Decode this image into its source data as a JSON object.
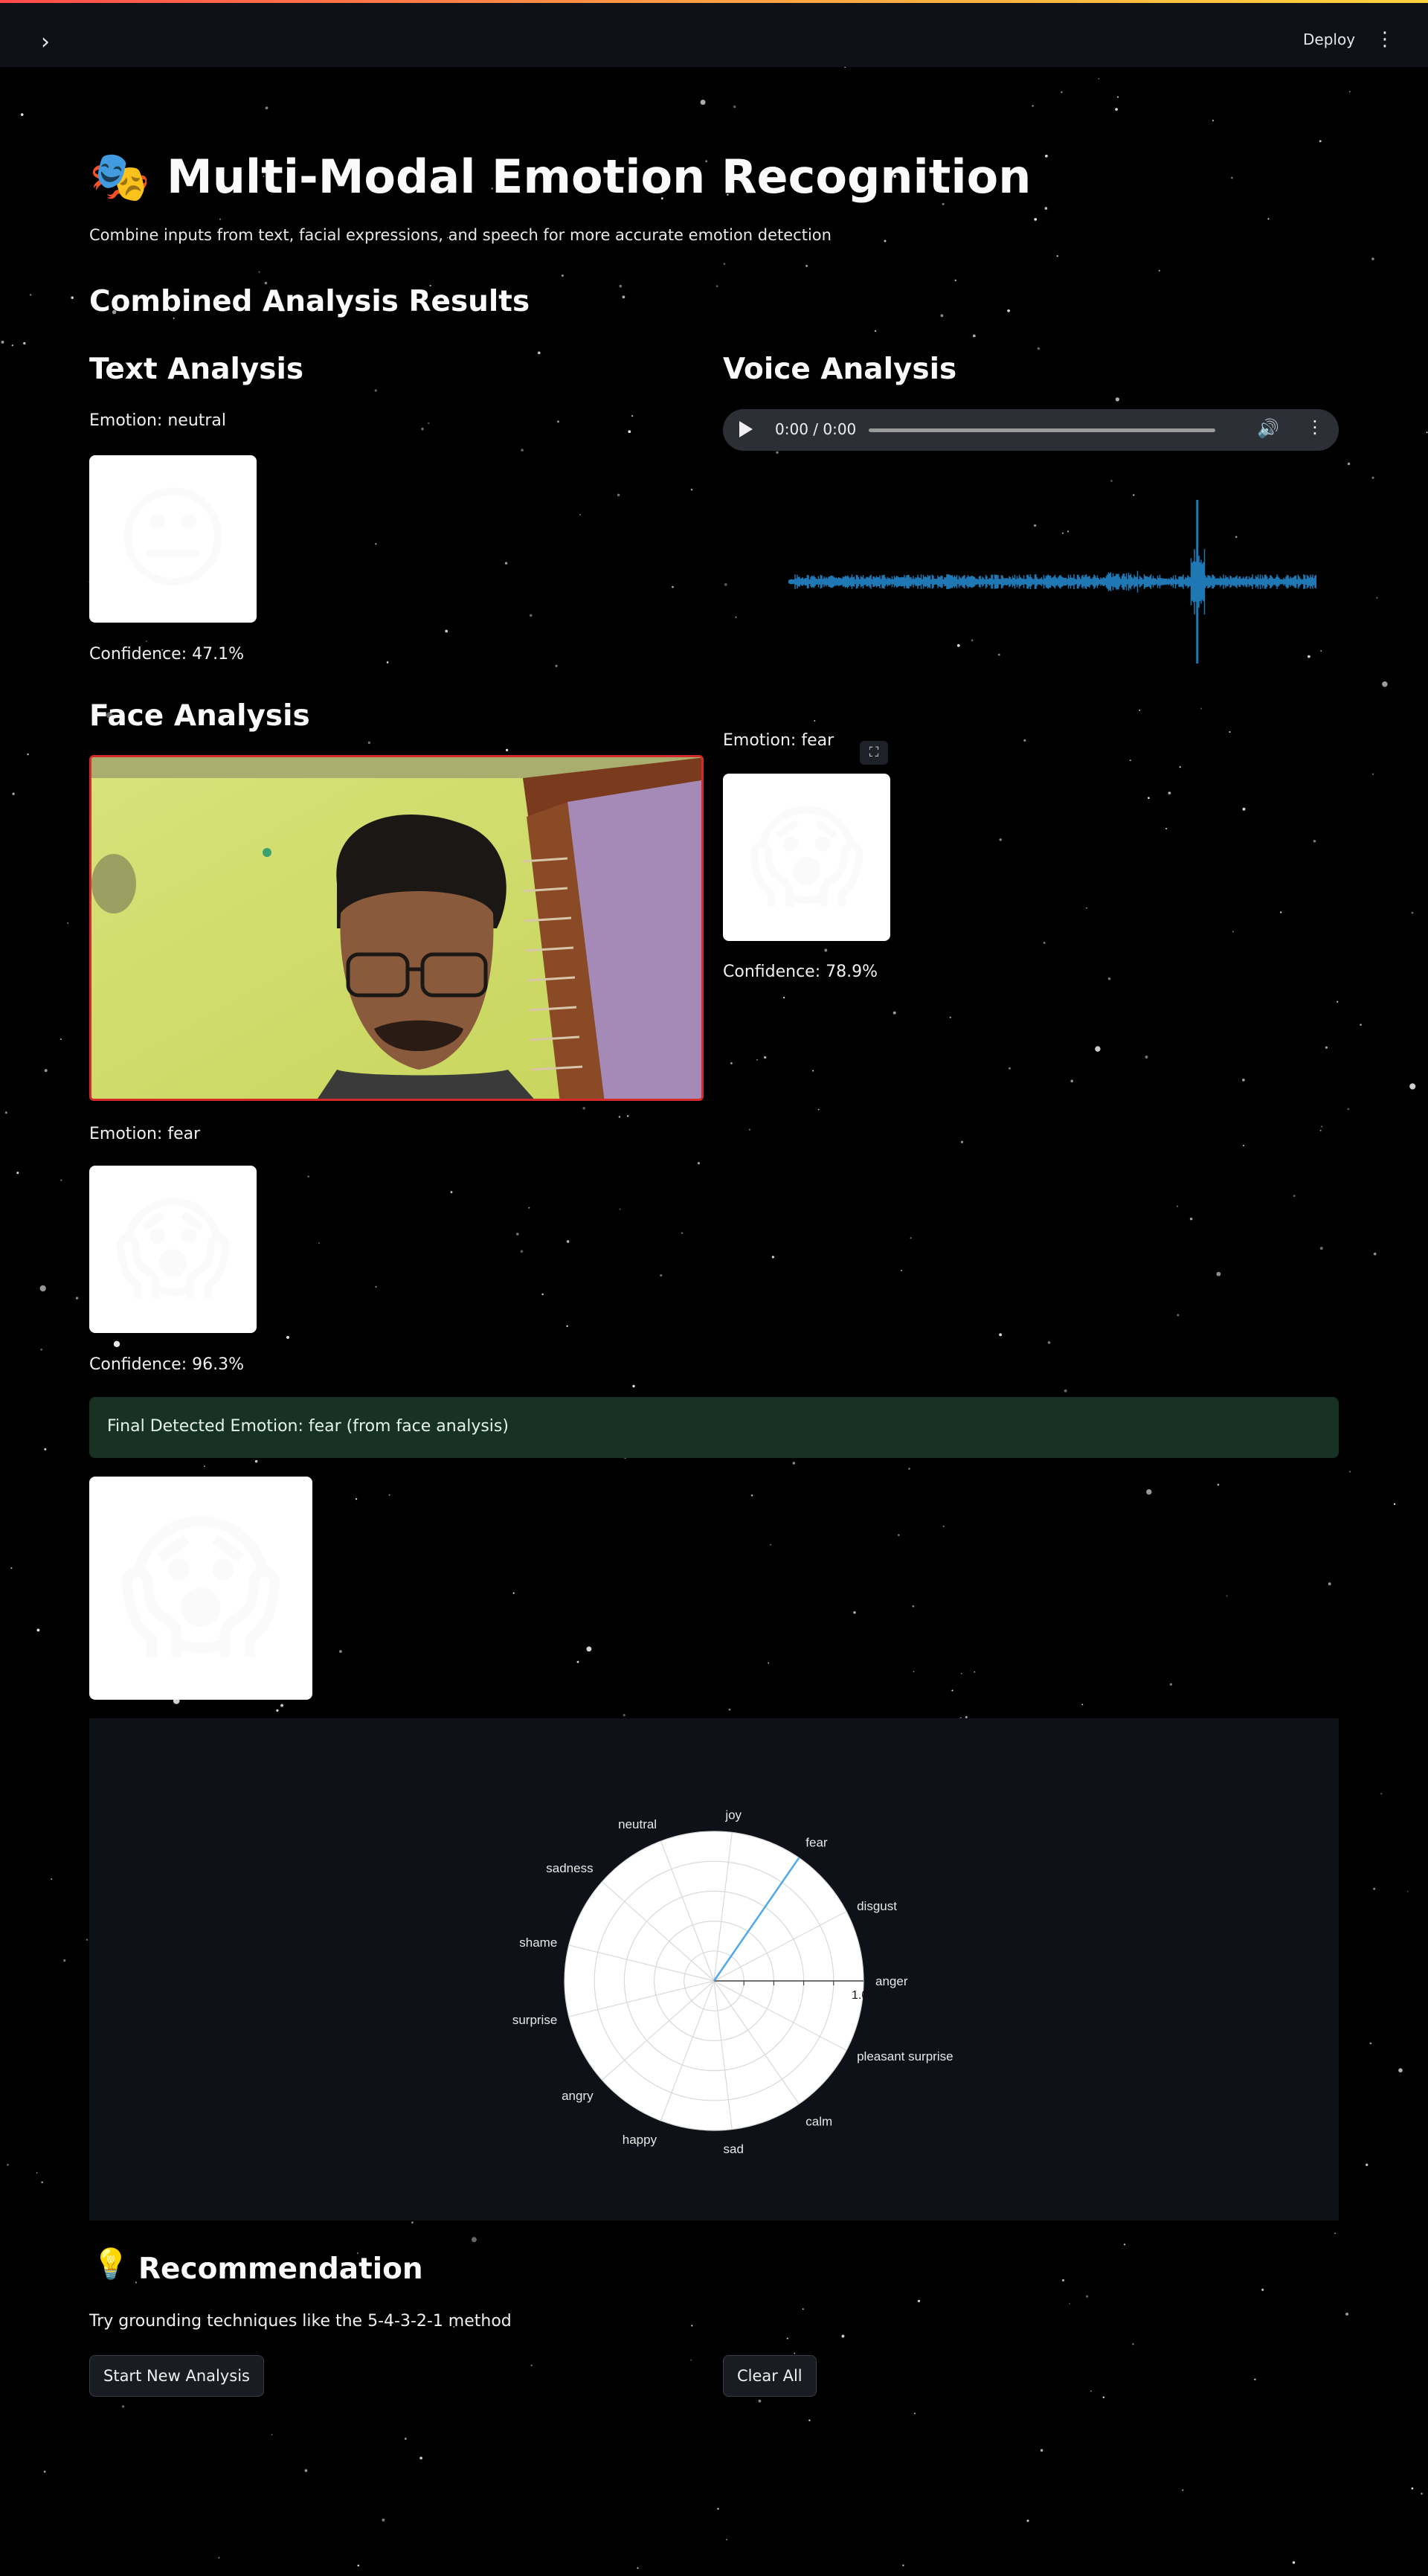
{
  "app": {
    "deploy_label": "Deploy",
    "sidebar_toggle_icon": "chevron-right-icon",
    "menu_icon": "kebab-menu-icon",
    "accent_gradient": [
      "#ff4b4b",
      "#ff9f43",
      "#ffd33d"
    ]
  },
  "header": {
    "title_emoji": "🎭",
    "title": "Multi-Modal Emotion Recognition",
    "subtitle": "Combine inputs from text, facial expressions, and speech for more accurate emotion detection"
  },
  "combined": {
    "heading": "Combined Analysis Results"
  },
  "text_analysis": {
    "heading": "Text Analysis",
    "emotion_label": "Emotion: neutral",
    "emoji": "😐",
    "confidence": "Confidence: 47.1%"
  },
  "voice_analysis": {
    "heading": "Voice Analysis",
    "audio_time": "0:00 / 0:00",
    "waveform_color": "#1f77b4"
  },
  "face_analysis": {
    "heading": "Face Analysis",
    "side_emotion_label": "Emotion: fear",
    "side_emoji": "😱",
    "side_confidence": "Confidence: 78.9%",
    "emotion_label": "Emotion: fear",
    "emoji": "😱",
    "confidence": "Confidence: 96.3%",
    "webcam_frame_color": "#d42a2a"
  },
  "final": {
    "message": "Final Detected Emotion: fear (from face analysis)",
    "emoji": "😱",
    "color": "#173224"
  },
  "chart_data": {
    "type": "polar",
    "categories": [
      "anger",
      "disgust",
      "fear",
      "joy",
      "neutral",
      "sadness",
      "shame",
      "surprise",
      "angry",
      "happy",
      "sad",
      "calm",
      "pleasant surprise"
    ],
    "values": [
      0,
      0,
      1,
      0,
      0,
      0,
      0,
      0,
      0,
      0,
      0,
      0,
      0
    ],
    "radial_range": [
      0,
      1
    ],
    "radial_tick_label": "1.00",
    "line_color": "#4fa8e8",
    "grid": true
  },
  "recommendation": {
    "icon": "💡",
    "heading": "Recommendation",
    "text": "Try grounding techniques like the 5-4-3-2-1 method"
  },
  "actions": {
    "start_new": "Start New Analysis",
    "clear_all": "Clear All"
  }
}
